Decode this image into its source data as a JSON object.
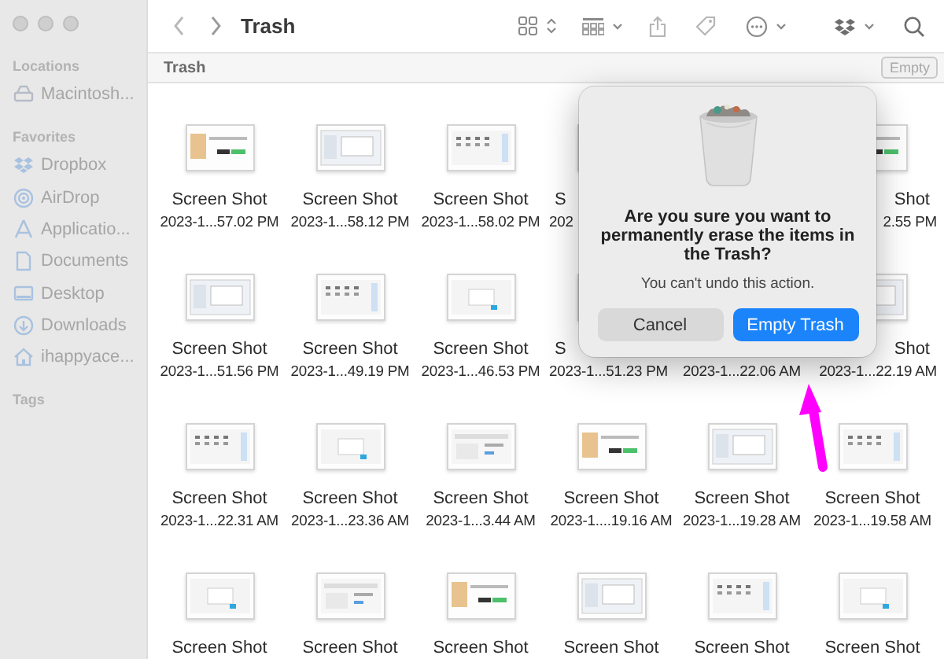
{
  "window": {
    "title": "Trash"
  },
  "sidebar": {
    "sections": [
      {
        "heading": "Locations",
        "items": [
          {
            "label": "Macintosh...",
            "kind": "disk"
          }
        ]
      },
      {
        "heading": "Favorites",
        "items": [
          {
            "label": "Dropbox",
            "kind": "dropbox"
          },
          {
            "label": "AirDrop",
            "kind": "airdrop"
          },
          {
            "label": "Applicatio...",
            "kind": "apps"
          },
          {
            "label": "Documents",
            "kind": "document"
          },
          {
            "label": "Desktop",
            "kind": "desktop"
          },
          {
            "label": "Downloads",
            "kind": "download"
          },
          {
            "label": "ihappyace...",
            "kind": "home"
          }
        ]
      },
      {
        "heading": "Tags"
      }
    ]
  },
  "path_bar": {
    "label": "Trash",
    "button": "Empty"
  },
  "files": [
    {
      "kind": "file",
      "name": "Screen Shot",
      "date": "2023-1...57.02 PM"
    },
    {
      "kind": "file",
      "name": "Screen Shot",
      "date": "2023-1...58.12 PM"
    },
    {
      "kind": "file",
      "name": "Screen Shot",
      "date": "2023-1...58.02 PM"
    },
    {
      "kind": "cut_right",
      "name": "S",
      "date": "202"
    },
    {
      "kind": "covered"
    },
    {
      "kind": "cut_left",
      "name": "Shot",
      "date": "2.55 PM"
    },
    {
      "kind": "file",
      "name": "Screen Shot",
      "date": "2023-1...51.56 PM"
    },
    {
      "kind": "file",
      "name": "Screen Shot",
      "date": "2023-1...49.19 PM"
    },
    {
      "kind": "file",
      "name": "Screen Shot",
      "date": "2023-1...46.53 PM"
    },
    {
      "kind": "cut_right",
      "name": "S",
      "date": "2023-1...51.23 PM"
    },
    {
      "kind": "covered",
      "date": "2023-1...22.06 AM"
    },
    {
      "kind": "cut_left",
      "name": "Shot",
      "date": "2023-1...22.19 AM"
    },
    {
      "kind": "file",
      "name": "Screen Shot",
      "date": "2023-1...22.31 AM"
    },
    {
      "kind": "file",
      "name": "Screen Shot",
      "date": "2023-1...23.36 AM"
    },
    {
      "kind": "file",
      "name": "Screen Shot",
      "date": "2023-1...3.44 AM"
    },
    {
      "kind": "file",
      "name": "Screen Shot",
      "date": "2023-1....19.16 AM"
    },
    {
      "kind": "file",
      "name": "Screen Shot",
      "date": "2023-1...19.28 AM"
    },
    {
      "kind": "file",
      "name": "Screen Shot",
      "date": "2023-1...19.58 AM"
    },
    {
      "kind": "file",
      "name": "Screen Shot"
    },
    {
      "kind": "file",
      "name": "Screen Shot"
    },
    {
      "kind": "file",
      "name": "Screen Shot"
    },
    {
      "kind": "file",
      "name": "Screen Shot"
    },
    {
      "kind": "file",
      "name": "Screen Shot"
    },
    {
      "kind": "file",
      "name": "Screen Shot"
    }
  ],
  "dialog": {
    "title": "Are you sure you want to permanently erase the items in the Trash?",
    "message": "You can't undo this action.",
    "buttons": [
      {
        "label": "Cancel",
        "kind": "secondary"
      },
      {
        "label": "Empty Trash",
        "kind": "primary"
      }
    ]
  }
}
